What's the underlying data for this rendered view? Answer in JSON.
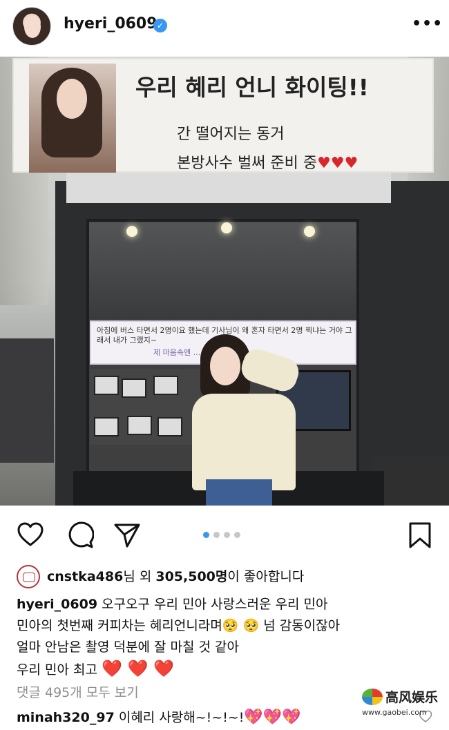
{
  "header": {
    "username": "hyeri_0609",
    "verified_icon": "verified-badge-icon",
    "more_label": "•••"
  },
  "photo": {
    "banner_title": "우리 혜리 언니 화이팅!!",
    "banner_line1": "간 떨어지는 동거",
    "banner_line2_text": "본방사수 벌써 준비 중",
    "banner_line2_hearts": "♥♥♥",
    "sign_text": "아침에 버스 타면서 2명이요 했는데 기사님이 왜 혼자 타면서 2명 찍냐는 거야 그래서 내가 그랬지~",
    "sign_text_line2": "제 마음속엔 ..."
  },
  "actions": {
    "like_icon": "heart-icon",
    "comment_icon": "comment-icon",
    "share_icon": "send-icon",
    "save_icon": "bookmark-icon",
    "carousel_total": 4,
    "carousel_active": 1
  },
  "likes": {
    "liker": "cnstka486",
    "text_mid": "님 외 ",
    "count": "305,500명",
    "text_end": "이 좋아합니다"
  },
  "caption": {
    "username": "hyeri_0609",
    "line1": " 오구오구 우리 민아 사랑스러운 우리 민아",
    "line2_a": "민아의 첫번째 커피차는 혜리언니라며",
    "line2_emojis": "🥺 🥺",
    "line2_b": " 넘 감동이잖아",
    "line3": "얼마 안남은 촬영 덕분에 잘 마칠 것 같아",
    "line4": "우리 민아 최고 ",
    "line4_hearts": "❤️ ❤️ ❤️"
  },
  "comments": {
    "view_all": "댓글 495개 모두 보기",
    "first_user": "minah320_97",
    "first_text": " 이혜리 사랑해~!~!~!",
    "first_hearts": "💖💖💖"
  },
  "watermark": {
    "title": "高风娱乐",
    "url": "www.gaobei.com"
  },
  "colors": {
    "accent_blue": "#3897f0",
    "heart_red": "#e0262d",
    "muted_text": "#8e8e8e"
  }
}
